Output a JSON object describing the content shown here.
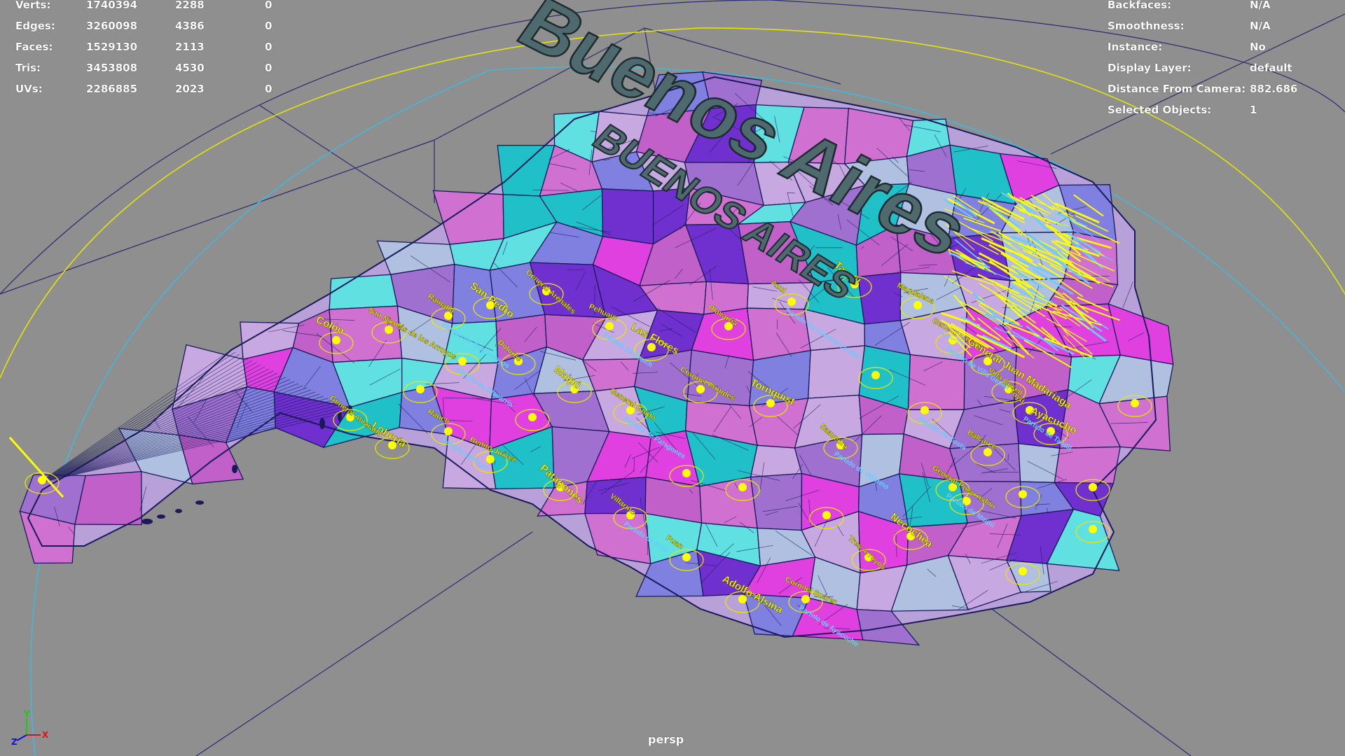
{
  "app": {
    "viewport_name": "persp"
  },
  "hud_left": {
    "rows": [
      {
        "label": "Verts:",
        "total": "1740394",
        "selected": "2288",
        "extra": "0"
      },
      {
        "label": "Edges:",
        "total": "3260098",
        "selected": "4386",
        "extra": "0"
      },
      {
        "label": "Faces:",
        "total": "1529130",
        "selected": "2113",
        "extra": "0"
      },
      {
        "label": "Tris:",
        "total": "3453808",
        "selected": "4530",
        "extra": "0"
      },
      {
        "label": "UVs:",
        "total": "2286885",
        "selected": "2023",
        "extra": "0"
      }
    ]
  },
  "hud_right": {
    "rows": [
      {
        "label": "Backfaces:",
        "value": "N/A"
      },
      {
        "label": "Smoothness:",
        "value": "N/A"
      },
      {
        "label": "Instance:",
        "value": "No"
      },
      {
        "label": "Display Layer:",
        "value": "default"
      },
      {
        "label": "Distance From Camera:",
        "value": "882.686"
      },
      {
        "label": "Selected Objects:",
        "value": "1"
      }
    ]
  },
  "scene_text": {
    "title_3d": "Buenos Aires",
    "title_embossed": "BUENOS AIRES"
  },
  "map_labels_yellow": [
    "Colón",
    "San Nicolás de los Arroyos",
    "Ramallo",
    "San Pedro",
    "General Arenales",
    "Pehuajó",
    "Las Flores",
    "Olavarría",
    "Azul",
    "Tandil",
    "Magdalena",
    "General Lavalle",
    "General Juan Madariaga",
    "Villa Gesell",
    "Tuyú",
    "Ayacucho",
    "Balcarce",
    "General Pueyrredón",
    "Necochea",
    "Tres Arroyos",
    "Coronel Suárez",
    "Adolfo Alsina",
    "Puan",
    "Villarino",
    "Patagones",
    "Benito Juárez",
    "Rauch",
    "Lobería",
    "General Alvarado",
    "Saavedra",
    "Tornquist",
    "Coronel Pringles",
    "General Guido",
    "Maipú",
    "Dolores"
  ],
  "map_labels_blue": [
    "Partido de Tres Arroyos",
    "Partido de Rauch",
    "Partido de General Lavalle",
    "Partido de Villa Gesell",
    "Partido de Tandil",
    "Partido de Maipú",
    "Partido de Ayacucho",
    "Partido de Azul",
    "Partido de Puan",
    "Partido de Villarino",
    "Partido de Patagones",
    "Partido de Olavarría",
    "Partido de Costa"
  ],
  "axis_gizmo": {
    "x": "X",
    "y": "Y",
    "z": "Z"
  },
  "colors": {
    "background": "#8f8f8f",
    "wireframe": "#1a1a5a",
    "label_yellow": "#ffff00",
    "label_blue": "#66ccff",
    "text_3d": "#4f6a6f",
    "circle_yellow": "#e8e800",
    "circle_cyan": "#3fb8e0",
    "region_palette": [
      "#c8a8e0",
      "#a070d0",
      "#20c0c8",
      "#e040e0",
      "#8080e0",
      "#b0c0e0",
      "#d070d0",
      "#7030d0",
      "#60e0e0",
      "#c060c8"
    ]
  }
}
